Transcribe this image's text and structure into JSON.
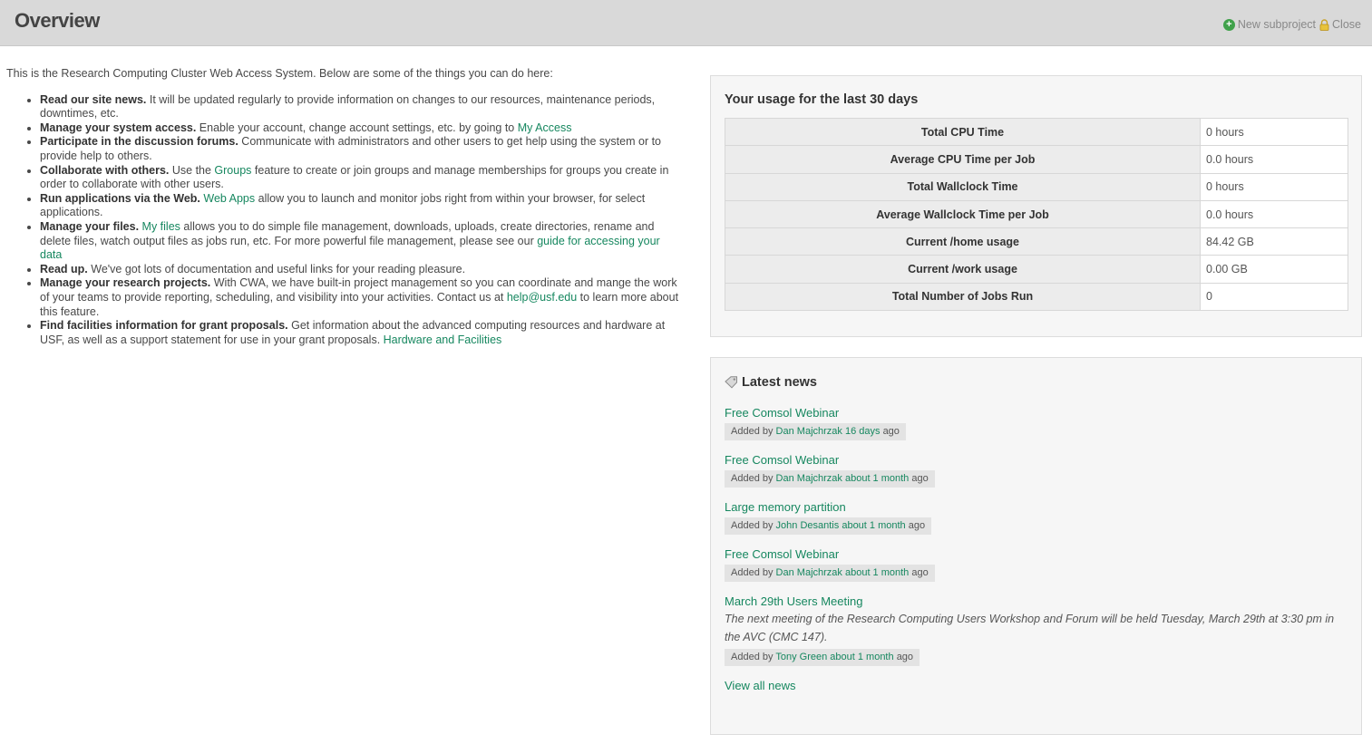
{
  "header": {
    "title": "Overview",
    "new_subproject": "New subproject",
    "close": "Close"
  },
  "intro": "This is the Research Computing Cluster Web Access System. Below are some of the things you can do here:",
  "features": [
    {
      "bold": "Read our site news.",
      "parts": [
        " It will be updated regularly to provide information on changes to our resources, maintenance periods, downtimes, etc."
      ]
    },
    {
      "bold": "Manage your system access.",
      "t1": " Enable your account, change account settings, etc. by going to ",
      "l1": "My Access"
    },
    {
      "bold": "Participate in the discussion forums.",
      "t1": " Communicate with administrators and other users to get help using the system or to provide help to others."
    },
    {
      "bold": "Collaborate with others.",
      "t1": " Use the ",
      "l1": "Groups",
      "t2": " feature to create or join groups and manage memberships for groups you create in order to collaborate with other users."
    },
    {
      "bold": "Run applications via the Web.",
      "t1": " ",
      "l1": "Web Apps",
      "t2": " allow you to launch and monitor jobs right from within your browser, for select applications."
    },
    {
      "bold": "Manage your files.",
      "t1": " ",
      "l1": "My files",
      "t2": " allows you to do simple file management, downloads, uploads, create directories, rename and delete files, watch output files as jobs run, etc. For more powerful file management, please see our ",
      "l2": "guide for accessing your data"
    },
    {
      "bold": "Read up.",
      "t1": " We've got lots of documentation and useful links for your reading pleasure."
    },
    {
      "bold": "Manage your research projects.",
      "t1": " With CWA, we have built-in project management so you can coordinate and mange the work of your teams to provide reporting, scheduling, and visibility into your activities. Contact us at ",
      "l1": "help@usf.edu",
      "t2": " to learn more about this feature."
    },
    {
      "bold": "Find facilities information for grant proposals.",
      "t1": " Get information about the advanced computing resources and hardware at USF, as well as a support statement for use in your grant proposals. ",
      "l1": "Hardware and Facilities"
    }
  ],
  "usage": {
    "title": "Your usage for the last 30 days",
    "rows": [
      {
        "label": "Total CPU Time",
        "value": "0 hours"
      },
      {
        "label": "Average CPU Time per Job",
        "value": "0.0 hours"
      },
      {
        "label": "Total Wallclock Time",
        "value": "0 hours"
      },
      {
        "label": "Average Wallclock Time per Job",
        "value": "0.0 hours"
      },
      {
        "label": "Current /home usage",
        "value": "84.42 GB"
      },
      {
        "label": "Current /work usage",
        "value": "0.00 GB"
      },
      {
        "label": "Total Number of Jobs Run",
        "value": "0"
      }
    ]
  },
  "news": {
    "title": "Latest news",
    "added_by": "Added by",
    "ago": "ago",
    "items": [
      {
        "title": "Free Comsol Webinar",
        "author": "Dan Majchrzak",
        "time": "16 days"
      },
      {
        "title": "Free Comsol Webinar",
        "author": "Dan Majchrzak",
        "time": "about 1 month"
      },
      {
        "title": "Large memory partition",
        "author": "John Desantis",
        "time": "about 1 month"
      },
      {
        "title": "Free Comsol Webinar",
        "author": "Dan Majchrzak",
        "time": "about 1 month"
      },
      {
        "title": "March 29th Users Meeting",
        "summary": "The next meeting of the Research Computing Users Workshop and Forum will be held Tuesday, March 29th at 3:30 pm in the AVC (CMC 147).",
        "author": "Tony Green",
        "time": "about 1 month"
      }
    ],
    "view_all": "View all news"
  },
  "colors": {
    "link": "#16875f",
    "header_bg": "#d9d9d9",
    "box_bg": "#f6f6f6"
  },
  "icons": {
    "new_subproject": "plus-circle-icon",
    "close": "lock-icon",
    "news": "tag-icon"
  }
}
